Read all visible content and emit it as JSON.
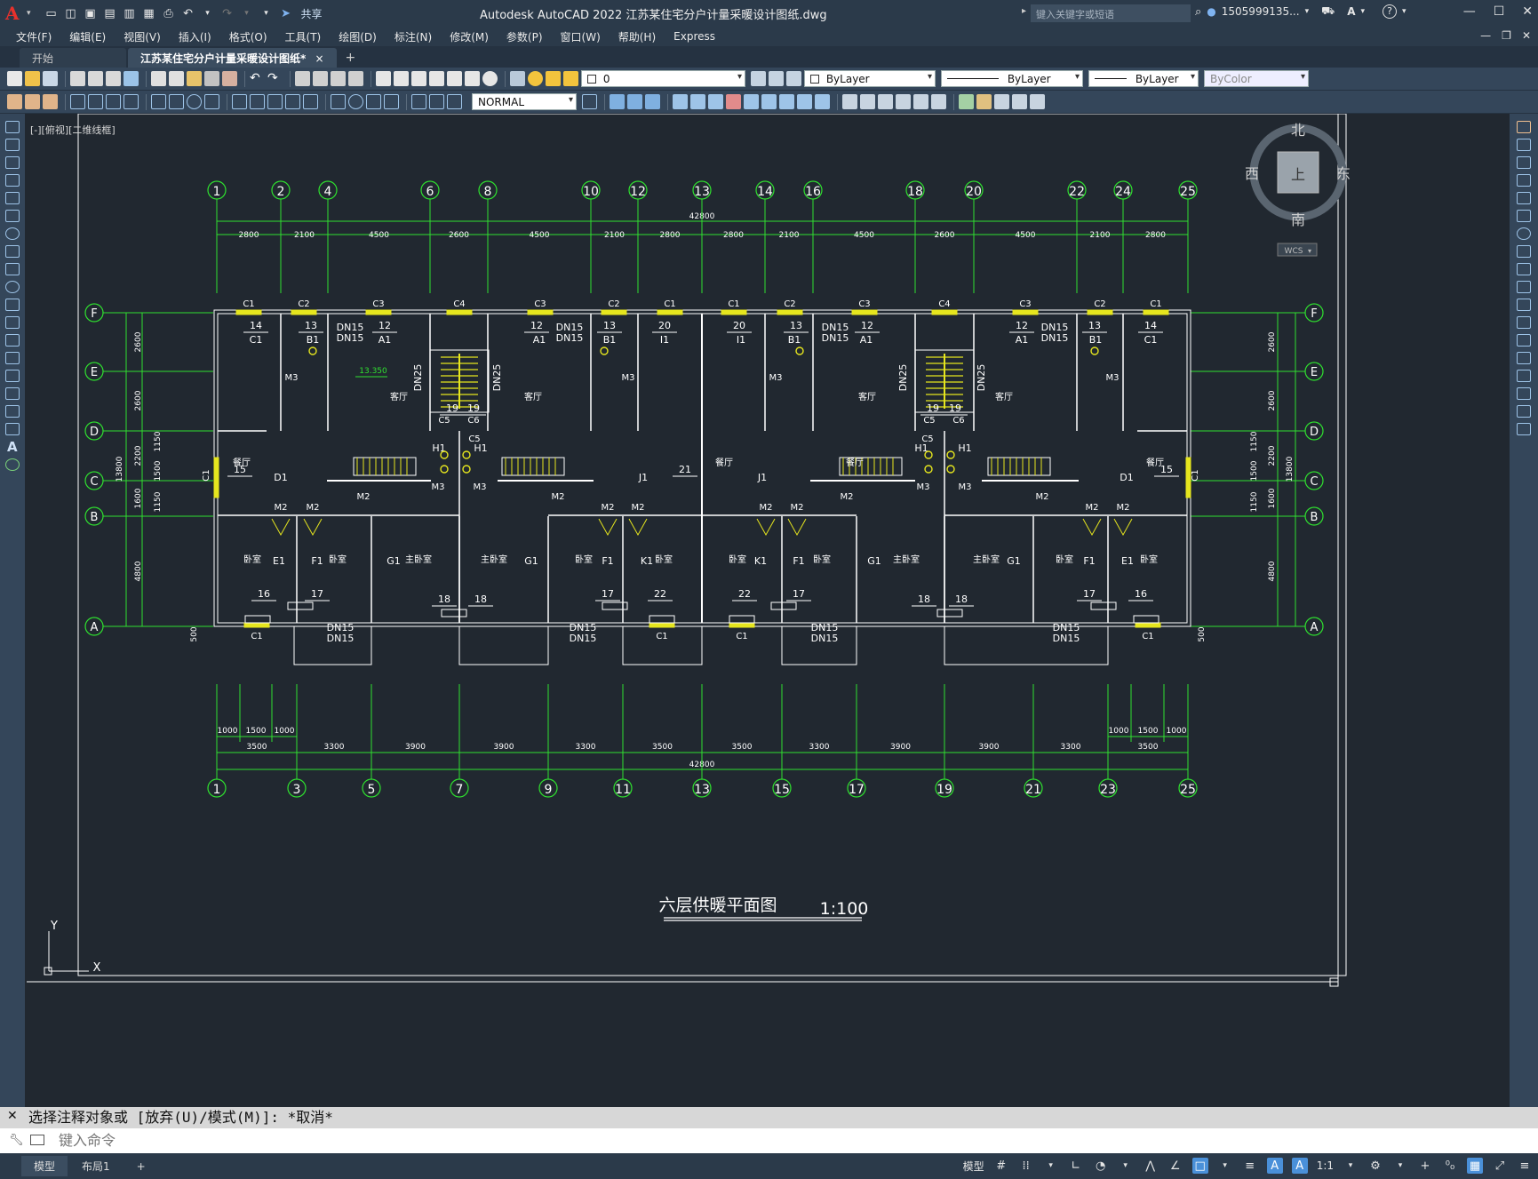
{
  "titlebar": {
    "logo": "A",
    "share": "共享",
    "title": "Autodesk AutoCAD 2022    江苏某住宅分户计量采暖设计图纸.dwg",
    "search_placeholder": "键入关键字或短语",
    "user": "1505999135...",
    "cart_icon": "cart-icon",
    "help": "?"
  },
  "menu": [
    "文件(F)",
    "编辑(E)",
    "视图(V)",
    "插入(I)",
    "格式(O)",
    "工具(T)",
    "绘图(D)",
    "标注(N)",
    "修改(M)",
    "参数(P)",
    "窗口(W)",
    "帮助(H)",
    "Express"
  ],
  "tabs": {
    "start": "开始",
    "drawing": "江苏某住宅分户计量采暖设计图纸*",
    "close": "×",
    "add": "+"
  },
  "toolbar": {
    "layer_value": "0",
    "color": "ByLayer",
    "linetype": "ByLayer",
    "lineweight": "ByLayer",
    "plotstyle": "ByColor",
    "dimstyle": "NORMAL"
  },
  "viewport": {
    "label": "[-][俯视][二维线框]"
  },
  "viewcube": {
    "north": "北",
    "south": "南",
    "east": "东",
    "west": "西",
    "top": "上",
    "wcs": "WCS"
  },
  "ucs": {
    "x": "X",
    "y": "Y"
  },
  "drawing": {
    "title": "六层供暖平面图",
    "scale": "1:100",
    "top_grid": [
      "1",
      "2",
      "4",
      "6",
      "8",
      "10",
      "12",
      "13",
      "14",
      "16",
      "18",
      "20",
      "22",
      "24",
      "25"
    ],
    "bottom_grid": [
      "1",
      "3",
      "5",
      "7",
      "9",
      "11",
      "13",
      "15",
      "17",
      "19",
      "21",
      "23",
      "25"
    ],
    "row_grid": [
      "F",
      "E",
      "D",
      "C",
      "B",
      "A"
    ],
    "top_total": "42800",
    "top_dims": [
      "2800",
      "2100",
      "4500",
      "2600",
      "4500",
      "2100",
      "2800",
      "2800",
      "2100",
      "4500",
      "2600",
      "4500",
      "2100",
      "2800"
    ],
    "bottom_dims": [
      "3500",
      "3300",
      "3900",
      "3900",
      "3300",
      "3500",
      "3500",
      "3300",
      "3900",
      "3900",
      "3300",
      "3500"
    ],
    "bottom_total": "42800",
    "bottom_sub_left": [
      "1000",
      "1500",
      "1000"
    ],
    "bottom_sub_right": [
      "1000",
      "1500",
      "1000"
    ],
    "left_dims": [
      "2600",
      "2600",
      "2200",
      "1600",
      "4800"
    ],
    "left_sub": [
      "1150",
      "1500",
      "1150"
    ],
    "left_total": "13800",
    "bottom_extra": "500",
    "elevation": "13.350",
    "windows_top": [
      "C1",
      "C2",
      "C3",
      "C4",
      "C3",
      "C2",
      "C1",
      "C1",
      "C2",
      "C3",
      "C4",
      "C3",
      "C2",
      "C1"
    ],
    "room_labels": [
      "客厅",
      "客厅",
      "客厅",
      "客厅",
      "餐厅",
      "餐厅",
      "餐厅",
      "餐厅",
      "卧室",
      "卧室",
      "卧室",
      "卧室",
      "卧室",
      "卧室",
      "卧室",
      "卧室",
      "主卧室",
      "主卧室",
      "主卧室",
      "主卧室"
    ],
    "room_codes": [
      "A1",
      "A1",
      "A1",
      "A1",
      "B1",
      "B1",
      "B1",
      "B1",
      "C1",
      "C1",
      "D1",
      "D1",
      "E1",
      "E1",
      "F1",
      "F1",
      "F1",
      "F1",
      "G1",
      "G1",
      "G1",
      "G1",
      "H1",
      "H1",
      "H1",
      "H1",
      "I1",
      "I1",
      "J1",
      "J1",
      "K1",
      "K1"
    ],
    "doors": [
      "M2",
      "M2",
      "M2",
      "M2",
      "M2",
      "M2",
      "M2",
      "M2",
      "M2",
      "M2",
      "M2",
      "M2",
      "M3",
      "M3",
      "M3",
      "M3",
      "M3",
      "M3",
      "M3",
      "M3"
    ],
    "radiators": [
      "12",
      "13",
      "14",
      "15",
      "16",
      "17",
      "18",
      "19",
      "20",
      "21",
      "22"
    ],
    "pipes": [
      "DN15",
      "DN25"
    ],
    "other_windows": [
      "C5",
      "C6"
    ]
  },
  "command": {
    "history": "选择注释对象或 [放弃(U)/模式(M)]: *取消*",
    "placeholder": "键入命令"
  },
  "status": {
    "model_tab": "模型",
    "layout_tab": "布局1",
    "add": "+",
    "model": "模型",
    "scale": "1:1"
  }
}
